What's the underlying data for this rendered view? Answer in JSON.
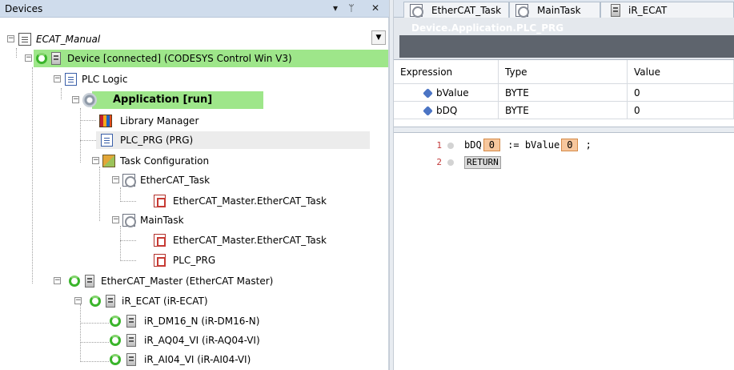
{
  "devices_pane": {
    "title": "Devices",
    "controls": {
      "dropdown": "▾",
      "pin": "ᛘ",
      "close": "✕"
    },
    "tree": [
      {
        "label": "ECAT_Manual",
        "icon": "project-icon"
      },
      {
        "label": "Device [connected] (CODESYS Control Win V3)",
        "icon": "device-icon"
      },
      {
        "label": "PLC Logic",
        "icon": "plc-logic-icon"
      },
      {
        "label": "Application [run]",
        "icon": "application-gear-icon"
      },
      {
        "label": "Library Manager",
        "icon": "library-icon"
      },
      {
        "label": "PLC_PRG (PRG)",
        "icon": "program-icon"
      },
      {
        "label": "Task Configuration",
        "icon": "task-config-icon"
      },
      {
        "label": "EtherCAT_Task",
        "icon": "task-icon"
      },
      {
        "label": "EtherCAT_Master.EtherCAT_Task",
        "icon": "program-call-icon"
      },
      {
        "label": "MainTask",
        "icon": "task-icon"
      },
      {
        "label": "EtherCAT_Master.EtherCAT_Task",
        "icon": "program-call-icon"
      },
      {
        "label": "PLC_PRG",
        "icon": "program-call-icon"
      },
      {
        "label": "EtherCAT_Master (EtherCAT Master)",
        "icon": "ethercat-master-icon"
      },
      {
        "label": "iR_ECAT (iR-ECAT)",
        "icon": "device-icon"
      },
      {
        "label": "iR_DM16_N (iR-DM16-N)",
        "icon": "device-icon"
      },
      {
        "label": "iR_AQ04_VI (iR-AQ04-VI)",
        "icon": "device-icon"
      },
      {
        "label": "iR_AI04_VI (iR-AI04-VI)",
        "icon": "device-icon"
      }
    ]
  },
  "editor": {
    "tabs": [
      {
        "label": "EtherCAT_Task",
        "icon": "task-icon"
      },
      {
        "label": "MainTask",
        "icon": "task-icon"
      },
      {
        "label": "iR_ECAT",
        "icon": "device-icon"
      }
    ],
    "pou_title": "Device.Application.PLC_PRG",
    "watch_table": {
      "headers": [
        "Expression",
        "Type",
        "Value"
      ],
      "rows": [
        {
          "expression": "bValue",
          "type": "BYTE",
          "value": "0"
        },
        {
          "expression": "bDQ",
          "type": "BYTE",
          "value": "0"
        }
      ]
    },
    "code": {
      "line_numbers": [
        "1",
        "2"
      ],
      "line1": {
        "var1": "bDQ",
        "val1": "0",
        "op": ":= bValue",
        "val2": "0",
        "end": ";"
      },
      "line2": {
        "keyword": "RETURN"
      }
    }
  },
  "colors": {
    "highlight_green": "#9ee68a",
    "header_blue": "#cfdcec",
    "title_dark": "#5e646d",
    "monitor_value_bg": "#f7c79d"
  }
}
